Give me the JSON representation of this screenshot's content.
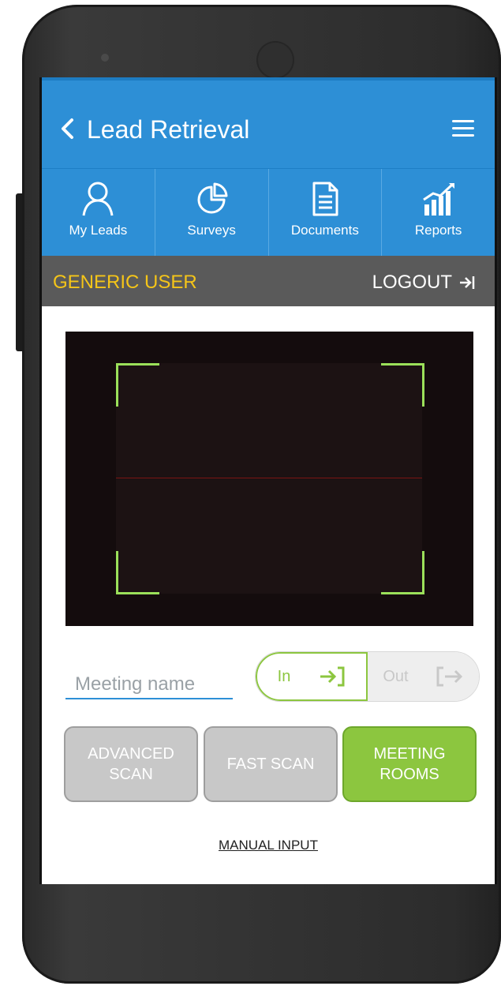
{
  "header": {
    "title": "Lead Retrieval",
    "back_icon": "chevron-left-icon",
    "menu_icon": "hamburger-menu-icon"
  },
  "tabs": [
    {
      "label": "My Leads",
      "icon": "user-icon"
    },
    {
      "label": "Surveys",
      "icon": "pie-chart-icon"
    },
    {
      "label": "Documents",
      "icon": "document-icon"
    },
    {
      "label": "Reports",
      "icon": "bar-chart-icon"
    }
  ],
  "userbar": {
    "username": "GENERIC USER",
    "logout_label": "LOGOUT"
  },
  "meeting": {
    "placeholder": "Meeting name",
    "toggle_in": "In",
    "toggle_out": "Out",
    "selected": "In"
  },
  "actions": {
    "advanced_scan": "ADVANCED\nSCAN",
    "fast_scan": "FAST SCAN",
    "meeting_rooms": "MEETING\nROOMS"
  },
  "footer": {
    "manual_input": "MANUAL INPUT"
  },
  "colors": {
    "header_blue": "#2d8fd6",
    "username_yellow": "#f5c518",
    "accent_green": "#8cc63f",
    "userbar_grey": "#5a5a5a"
  }
}
